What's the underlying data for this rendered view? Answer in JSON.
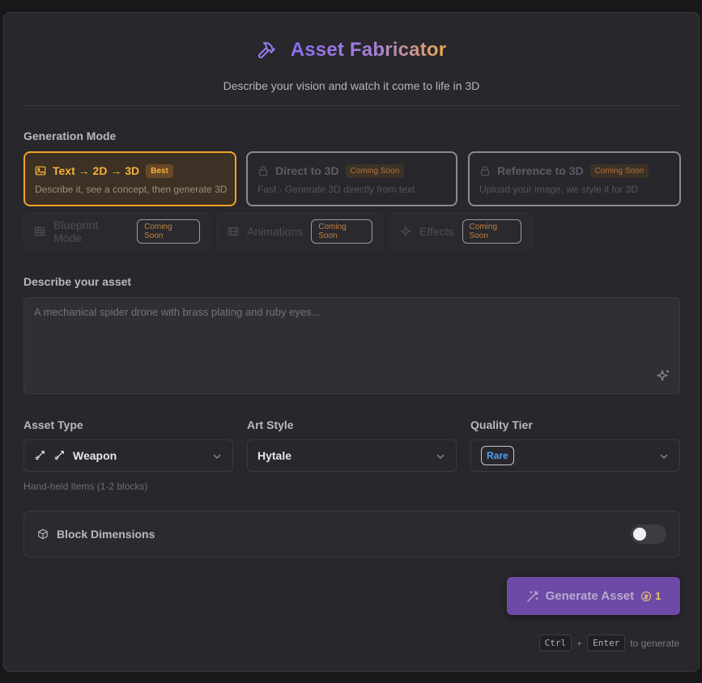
{
  "header": {
    "title": "Asset Fabricator",
    "subtitle": "Describe your vision and watch it come to life in 3D",
    "icon": "hammer-icon"
  },
  "generation_mode": {
    "label": "Generation Mode",
    "primary_modes": [
      {
        "name": "Text → 2D → 3D",
        "badge": "Best",
        "description": "Describe it, see a concept, then generate 3D",
        "active": true,
        "icon": "image-icon"
      },
      {
        "name": "Direct to 3D",
        "badge": "Coming Soon",
        "description": "Fast - Generate 3D directly from text",
        "active": false,
        "icon": "lock-icon"
      },
      {
        "name": "Reference to 3D",
        "badge": "Coming Soon",
        "description": "Upload your image, we style it for 3D",
        "active": false,
        "icon": "lock-icon"
      }
    ],
    "secondary_modes": [
      {
        "name": "Blueprint Mode",
        "badge": "Coming Soon",
        "icon": "grid-icon"
      },
      {
        "name": "Animations",
        "badge": "Coming Soon",
        "icon": "film-icon"
      },
      {
        "name": "Effects",
        "badge": "Coming Soon",
        "icon": "sparkle-icon"
      }
    ]
  },
  "description": {
    "label": "Describe your asset",
    "placeholder": "A mechanical spider drone with brass plating and ruby eyes...",
    "value": ""
  },
  "asset_type": {
    "label": "Asset Type",
    "value": "Weapon",
    "hint": "Hand-held items (1-2 blocks)",
    "icon": "sword-icon"
  },
  "art_style": {
    "label": "Art Style",
    "value": "Hytale"
  },
  "quality_tier": {
    "label": "Quality Tier",
    "value": "Rare",
    "color": "#5aa0f0"
  },
  "block_dimensions": {
    "label": "Block Dimensions",
    "enabled": false
  },
  "generate": {
    "label": "Generate Asset",
    "cost": "1"
  },
  "shortcut": {
    "key1": "Ctrl",
    "plus": "+",
    "key2": "Enter",
    "suffix": "to generate"
  },
  "colors": {
    "accent": "#f0a227",
    "brand": "#8b6cf0",
    "button": "#6d4aa8"
  }
}
